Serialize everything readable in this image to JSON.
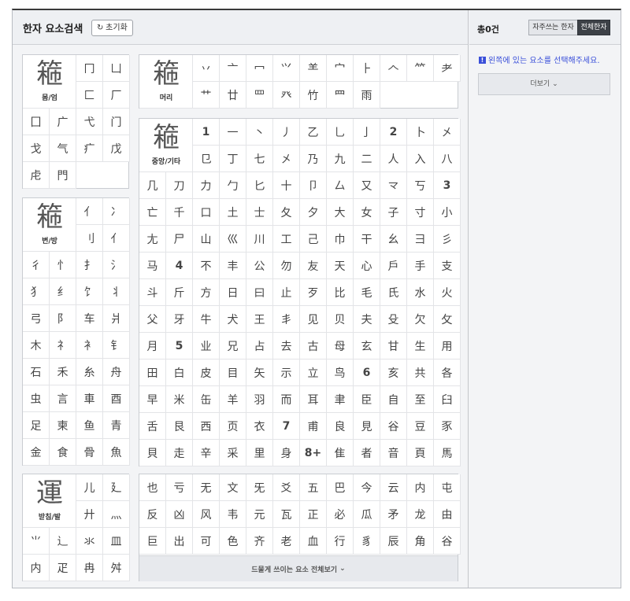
{
  "header": {
    "title": "한자 요소검색",
    "reset_label": "초기화",
    "reset_icon": "refresh-icon"
  },
  "right_panel": {
    "count": "총0건",
    "tab_frequent": "자주쓰는 한자",
    "tab_all": "전체한자",
    "hint": "왼쪽에 있는 요소를 선택해주세요.",
    "more_label": "더보기"
  },
  "groups": {
    "enclosure": {
      "label": "몸/엄",
      "glyph": "篐",
      "highlight": "匚",
      "items": [
        "冂",
        "凵",
        "匚",
        "厂",
        "囗",
        "广",
        "弋",
        "门",
        "戈",
        "气",
        "疒",
        "戊",
        "虍",
        "門"
      ]
    },
    "side": {
      "label": "변/방",
      "glyph": "篐",
      "highlight": "扌",
      "items": [
        "亻",
        "冫",
        "刂",
        "⺅",
        "彳",
        "忄",
        "扌",
        "氵",
        "犭",
        "纟",
        "饣",
        "丬",
        "弓",
        "阝",
        "车",
        "爿",
        "木",
        "礻",
        "衤",
        "钅",
        "石",
        "禾",
        "糸",
        "舟",
        "虫",
        "言",
        "車",
        "酉",
        "足",
        "柬",
        "鱼",
        "青",
        "金",
        "食",
        "骨",
        "魚"
      ]
    },
    "bottom": {
      "label": "받침/발",
      "glyph": "運",
      "highlight": "辶",
      "items": [
        "儿",
        "廴",
        "廾",
        "灬",
        "⺌",
        "辶",
        "氺",
        "皿",
        "内",
        "疋",
        "冉",
        "舛"
      ]
    },
    "head": {
      "label": "머리",
      "glyph": "篐",
      "highlight": "竹",
      "items": [
        "丷",
        "亠",
        "冖",
        "⺍",
        "⺷",
        "宀",
        "⺊",
        "𠆢",
        "⺮",
        "耂",
        "艹",
        "廿",
        "罒",
        "癶",
        "竹",
        "⺫",
        "雨"
      ]
    },
    "middle": {
      "label": "중앙/기타",
      "glyph": "篐",
      "highlight": "巾",
      "items": [
        {
          "t": "1",
          "s": true
        },
        {
          "t": "一"
        },
        {
          "t": "丶"
        },
        {
          "t": "丿"
        },
        {
          "t": "乙"
        },
        {
          "t": "乚"
        },
        {
          "t": "亅"
        },
        {
          "t": "2",
          "s": true
        },
        {
          "t": "卜"
        },
        {
          "t": "㐅"
        },
        {
          "t": "㔾"
        },
        {
          "t": "丁"
        },
        {
          "t": "七"
        },
        {
          "t": "㐅"
        },
        {
          "t": "乃"
        },
        {
          "t": "九"
        },
        {
          "t": "二"
        },
        {
          "t": "人"
        },
        {
          "t": "入"
        },
        {
          "t": "八"
        },
        {
          "t": "几"
        },
        {
          "t": "刀"
        },
        {
          "t": "力"
        },
        {
          "t": "勹"
        },
        {
          "t": "匕"
        },
        {
          "t": "十"
        },
        {
          "t": "卩"
        },
        {
          "t": "厶"
        },
        {
          "t": "又"
        },
        {
          "t": "龴"
        },
        {
          "t": "丂"
        },
        {
          "t": "3",
          "s": true
        },
        {
          "t": "亡"
        },
        {
          "t": "千"
        },
        {
          "t": "口"
        },
        {
          "t": "土"
        },
        {
          "t": "士"
        },
        {
          "t": "夂"
        },
        {
          "t": "夕"
        },
        {
          "t": "大"
        },
        {
          "t": "女"
        },
        {
          "t": "子"
        },
        {
          "t": "寸"
        },
        {
          "t": "小"
        },
        {
          "t": "尢"
        },
        {
          "t": "尸"
        },
        {
          "t": "山"
        },
        {
          "t": "巛"
        },
        {
          "t": "川"
        },
        {
          "t": "工"
        },
        {
          "t": "己"
        },
        {
          "t": "巾"
        },
        {
          "t": "干"
        },
        {
          "t": "幺"
        },
        {
          "t": "彐"
        },
        {
          "t": "彡"
        },
        {
          "t": "马"
        },
        {
          "t": "4",
          "s": true
        },
        {
          "t": "不"
        },
        {
          "t": "丰"
        },
        {
          "t": "公"
        },
        {
          "t": "勿"
        },
        {
          "t": "友"
        },
        {
          "t": "天"
        },
        {
          "t": "心"
        },
        {
          "t": "戶"
        },
        {
          "t": "手"
        },
        {
          "t": "支"
        },
        {
          "t": "斗"
        },
        {
          "t": "斤"
        },
        {
          "t": "方"
        },
        {
          "t": "日"
        },
        {
          "t": "曰"
        },
        {
          "t": "止"
        },
        {
          "t": "歹"
        },
        {
          "t": "比"
        },
        {
          "t": "毛"
        },
        {
          "t": "氏"
        },
        {
          "t": "水"
        },
        {
          "t": "火"
        },
        {
          "t": "父"
        },
        {
          "t": "牙"
        },
        {
          "t": "牛"
        },
        {
          "t": "犬"
        },
        {
          "t": "王"
        },
        {
          "t": "丯"
        },
        {
          "t": "见"
        },
        {
          "t": "贝"
        },
        {
          "t": "夫"
        },
        {
          "t": "殳"
        },
        {
          "t": "欠"
        },
        {
          "t": "攵"
        },
        {
          "t": "月"
        },
        {
          "t": "5",
          "s": true
        },
        {
          "t": "业"
        },
        {
          "t": "兄"
        },
        {
          "t": "占"
        },
        {
          "t": "去"
        },
        {
          "t": "古"
        },
        {
          "t": "母"
        },
        {
          "t": "玄"
        },
        {
          "t": "甘"
        },
        {
          "t": "生"
        },
        {
          "t": "用"
        },
        {
          "t": "田"
        },
        {
          "t": "白"
        },
        {
          "t": "皮"
        },
        {
          "t": "目"
        },
        {
          "t": "矢"
        },
        {
          "t": "示"
        },
        {
          "t": "立"
        },
        {
          "t": "鸟"
        },
        {
          "t": "6",
          "s": true
        },
        {
          "t": "亥"
        },
        {
          "t": "共"
        },
        {
          "t": "各"
        },
        {
          "t": "早"
        },
        {
          "t": "米"
        },
        {
          "t": "缶"
        },
        {
          "t": "羊"
        },
        {
          "t": "羽"
        },
        {
          "t": "而"
        },
        {
          "t": "耳"
        },
        {
          "t": "聿"
        },
        {
          "t": "臣"
        },
        {
          "t": "自"
        },
        {
          "t": "至"
        },
        {
          "t": "臼"
        },
        {
          "t": "舌"
        },
        {
          "t": "艮"
        },
        {
          "t": "西"
        },
        {
          "t": "页"
        },
        {
          "t": "衣"
        },
        {
          "t": "7",
          "s": true
        },
        {
          "t": "甫"
        },
        {
          "t": "良"
        },
        {
          "t": "見"
        },
        {
          "t": "谷"
        },
        {
          "t": "豆"
        },
        {
          "t": "豕"
        },
        {
          "t": "貝"
        },
        {
          "t": "走"
        },
        {
          "t": "辛"
        },
        {
          "t": "采"
        },
        {
          "t": "里"
        },
        {
          "t": "身"
        },
        {
          "t": "8+",
          "s": true
        },
        {
          "t": "隹"
        },
        {
          "t": "者"
        },
        {
          "t": "音"
        },
        {
          "t": "頁"
        },
        {
          "t": "馬"
        }
      ]
    },
    "rare": {
      "more_label": "드물게 쓰이는 요소 전체보기",
      "items": [
        "也",
        "亏",
        "无",
        "文",
        "旡",
        "爻",
        "五",
        "巴",
        "今",
        "云",
        "内",
        "屯",
        "反",
        "凶",
        "风",
        "韦",
        "元",
        "瓦",
        "正",
        "必",
        "瓜",
        "矛",
        "龙",
        "由",
        "巨",
        "出",
        "可",
        "色",
        "齐",
        "老",
        "血",
        "行",
        "豸",
        "辰",
        "角",
        "谷"
      ]
    }
  }
}
